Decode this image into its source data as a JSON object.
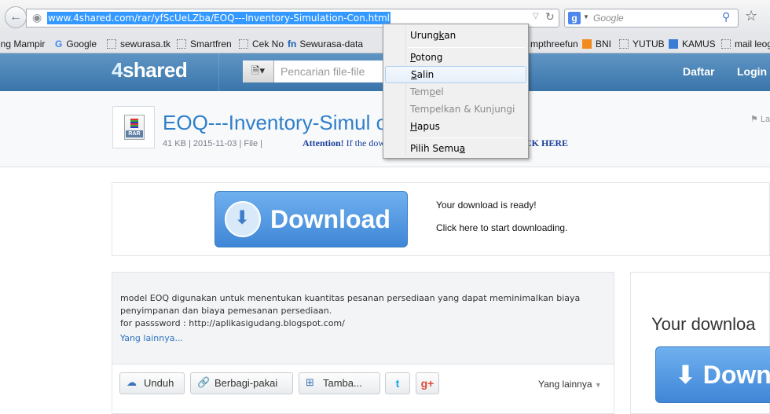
{
  "browser": {
    "url": "www.4shared.com/rar/yfScUeLZba/EOQ---Inventory-Simulation-Con.html",
    "search_placeholder": "Google"
  },
  "bookmarks": [
    {
      "label": "ing Mampir",
      "icon": "none"
    },
    {
      "label": "Google",
      "icon": "google"
    },
    {
      "label": "sewurasa.tk",
      "icon": "page"
    },
    {
      "label": "Smartfren",
      "icon": "page"
    },
    {
      "label": "Cek No",
      "icon": "page"
    },
    {
      "label": "Sewurasa-data",
      "icon": "fn"
    },
    {
      "label": "mpthreefun",
      "icon": "none"
    },
    {
      "label": "BNI",
      "icon": "bni"
    },
    {
      "label": "YUTUB",
      "icon": "page"
    },
    {
      "label": "KAMUS",
      "icon": "kamus"
    },
    {
      "label": "mail leog",
      "icon": "page"
    }
  ],
  "site": {
    "logo_prefix": "4",
    "logo_rest": "shared",
    "search_placeholder": "Pencarian file-file",
    "signup": "Daftar",
    "login": "Login"
  },
  "file": {
    "title": "EOQ---Inventory-Simul                          oq_e...",
    "meta": "41 KB | 2015-11-03 | File |",
    "attention_label": "Attention!",
    "attention_text": "If the dow",
    "click_here": "CK HERE",
    "report": "La"
  },
  "download": {
    "label": "Download",
    "ready": "Your download is ready!",
    "start": "Click here to start downloading."
  },
  "description": {
    "text": "model EOQ digunakan untuk menentukan kuantitas pesanan persediaan yang dapat meminimalkan biaya penyimpanan dan biaya pemesanan persediaan.",
    "password": "for passsword : http://aplikasigudang.blogspot.com/",
    "more": "Yang lainnya..."
  },
  "actions": {
    "unduh": "Unduh",
    "share": "Berbagi-pakai",
    "add": "Tamba...",
    "twitter": "t",
    "gplus": "g+",
    "more": "Yang lainnya"
  },
  "side": {
    "title": "Your downloa",
    "button": "Down"
  },
  "context_menu": {
    "items": [
      {
        "pre": "Urung",
        "key": "k",
        "post": "an"
      },
      {
        "pre": "",
        "key": "P",
        "post": "otong"
      },
      {
        "pre": "",
        "key": "S",
        "post": "alin"
      },
      {
        "pre": "Tem",
        "key": "p",
        "post": "el"
      },
      {
        "pre": "Tempelkan & Kunjungi",
        "key": "",
        "post": ""
      },
      {
        "pre": "",
        "key": "H",
        "post": "apus"
      },
      {
        "pre": "Pilih Semu",
        "key": "a",
        "post": ""
      }
    ]
  }
}
